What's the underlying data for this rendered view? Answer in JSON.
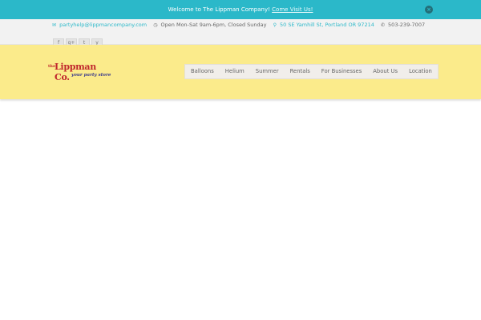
{
  "topbar": {
    "message": "Welcome to The Lippman Company!",
    "link": "Come Visit Us!",
    "close_icon": "close-icon",
    "background": "#2bb8c9"
  },
  "infobar": {
    "email": "partyhelp@lippmancompany.com",
    "hours": "Open Mon-Sat 9am-6pm, Closed Sunday",
    "address": "50 SE Yamhill St, Portland OR 97214",
    "phone": "503-239-7007",
    "icons": [
      "envelope-icon",
      "clock-icon",
      "map-pin-icon",
      "phone-icon"
    ],
    "socials": [
      {
        "icon": "facebook-icon",
        "glyph": "f"
      },
      {
        "icon": "google-plus-icon",
        "glyph": "g+"
      },
      {
        "icon": "twitter-icon",
        "glyph": "t"
      },
      {
        "icon": "yelp-icon",
        "glyph": "y"
      }
    ]
  },
  "header": {
    "background": "#fbeb8b",
    "logo": {
      "the": "the",
      "name": "Lippman Co.",
      "tagline": "your party store"
    },
    "nav": [
      "Balloons",
      "Helium",
      "Summer",
      "Rentals",
      "For Businesses",
      "About Us",
      "Location"
    ]
  }
}
